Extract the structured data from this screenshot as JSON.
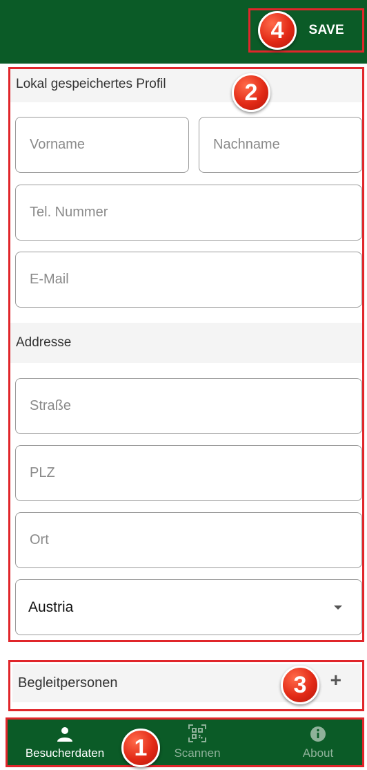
{
  "appbar": {
    "save_label": "SAVE"
  },
  "markers": {
    "m1": "1",
    "m2": "2",
    "m3": "3",
    "m4": "4"
  },
  "profile": {
    "section_title": "Lokal gespeichertes Profil",
    "first_name_placeholder": "Vorname",
    "last_name_placeholder": "Nachname",
    "phone_placeholder": "Tel. Nummer",
    "email_placeholder": "E-Mail",
    "address_title": "Addresse",
    "street_placeholder": "Straße",
    "zip_placeholder": "PLZ",
    "city_placeholder": "Ort",
    "country_value": "Austria"
  },
  "companions": {
    "title": "Begleitpersonen",
    "add_symbol": "+"
  },
  "nav": {
    "items": [
      {
        "label": "Besucherdaten",
        "icon": "person-icon",
        "active": true
      },
      {
        "label": "Scannen",
        "icon": "qr-code-icon",
        "active": false
      },
      {
        "label": "About",
        "icon": "info-icon",
        "active": false
      }
    ]
  },
  "colors": {
    "primary": "#0b5b27",
    "annotation": "#e0262b",
    "marker": "#e22a16"
  }
}
